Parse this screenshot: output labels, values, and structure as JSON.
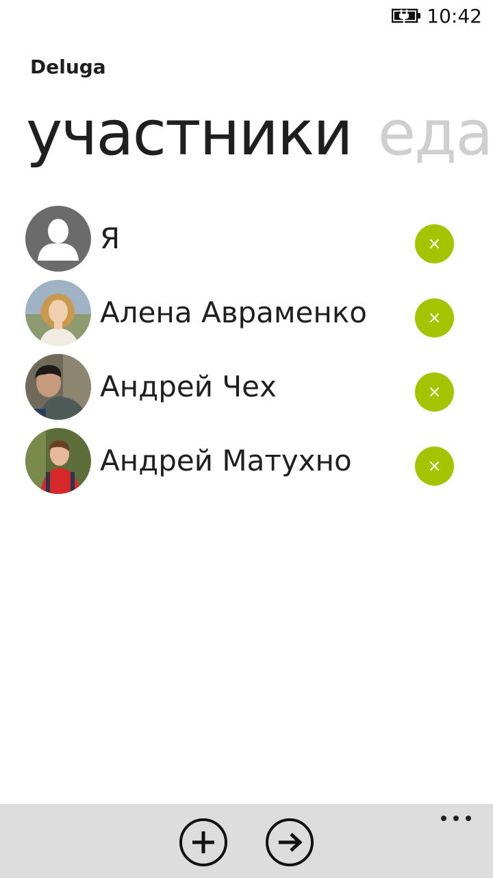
{
  "status_bar": {
    "time": "10:42",
    "battery_icon": "battery-charging-icon"
  },
  "app": {
    "title": "Deluga"
  },
  "pivot": {
    "items": [
      {
        "label": "участники"
      },
      {
        "label": "еда"
      }
    ]
  },
  "participants": [
    {
      "name": "Я",
      "avatar": "default-user-icon",
      "remove_icon": "close-icon"
    },
    {
      "name": "Алена Авраменко",
      "avatar": "photo-avatar",
      "remove_icon": "close-icon"
    },
    {
      "name": "Андрей Чех",
      "avatar": "photo-avatar",
      "remove_icon": "close-icon"
    },
    {
      "name": "Андрей Матухно",
      "avatar": "photo-avatar",
      "remove_icon": "close-icon"
    }
  ],
  "remove_symbol": "×",
  "app_bar": {
    "buttons": [
      {
        "icon": "add-icon"
      },
      {
        "icon": "arrow-right-icon"
      }
    ],
    "more_icon": "more-dots-icon"
  },
  "colors": {
    "accent": "#a4c400",
    "app_bar_bg": "#dddddd",
    "inactive_pivot": "#cfcfcf",
    "text": "#1f1f1f"
  }
}
